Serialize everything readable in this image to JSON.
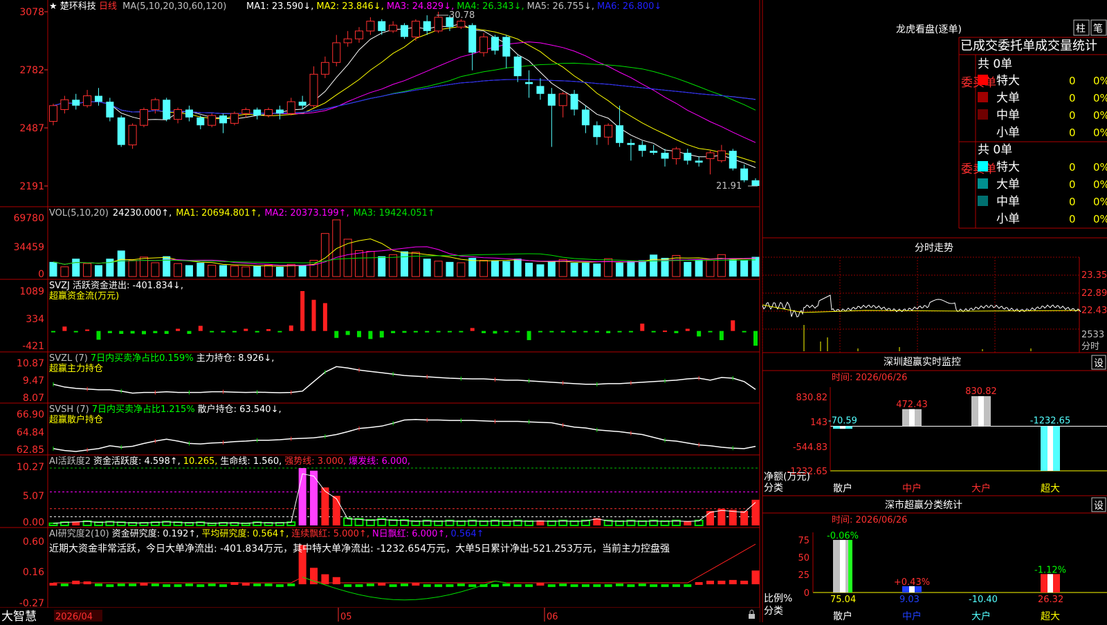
{
  "stock": {
    "star": "★",
    "name": "楚环科技",
    "period": "日线"
  },
  "main": {
    "ma_header": "MA(5,10,20,30,60,120)",
    "ma_items": [
      {
        "text": "MA1: 23.590↓,",
        "color": "#ffffff"
      },
      {
        "text": "MA2: 23.846↓,",
        "color": "#ffff00"
      },
      {
        "text": "MA3: 24.829↓,",
        "color": "#ff00ff"
      },
      {
        "text": "MA4: 26.343↓,",
        "color": "#00e000"
      },
      {
        "text": "MA5: 26.755↓,",
        "color": "#c0c0c0"
      },
      {
        "text": "MA6: 26.800↓",
        "color": "#2020ff"
      }
    ],
    "y_ticks": [
      "3078",
      "2782",
      "2487",
      "2191"
    ],
    "high_label": "30.78",
    "low_label": "21.91"
  },
  "vol": {
    "header": [
      {
        "text": "VOL(5,10,20)",
        "color": "#c0c0c0"
      },
      {
        "text": "24230.000↑,",
        "color": "#ffffff"
      },
      {
        "text": "MA1: 20694.801↑,",
        "color": "#ffff00"
      },
      {
        "text": "MA2: 20373.199↑,",
        "color": "#ff00ff"
      },
      {
        "text": "MA3: 19424.051↑",
        "color": "#00e000"
      }
    ],
    "y_ticks": [
      "69780",
      "34459",
      "0"
    ]
  },
  "svzj": {
    "header": [
      {
        "text": "SVZJ  活跃资金进出: -401.834↓,",
        "color": "#ffffff"
      }
    ],
    "sub": "超赢资金流(万元)",
    "y_ticks": [
      "1089",
      "334",
      "-421"
    ]
  },
  "svzl": {
    "header": [
      {
        "text": "SVZL (7)",
        "color": "#c0c0c0"
      },
      {
        "text": "7日内买卖净占比0.159%",
        "color": "#00ff00"
      },
      {
        "text": "主力持仓: 8.926↓,",
        "color": "#ffffff"
      }
    ],
    "sub": "超赢主力持仓",
    "y_ticks": [
      "10.87",
      "9.47",
      "8.07"
    ]
  },
  "svsh": {
    "header": [
      {
        "text": "SVSH (7)",
        "color": "#c0c0c0"
      },
      {
        "text": "7日内买卖净占比1.215%",
        "color": "#00ff00"
      },
      {
        "text": "散户持仓: 63.540↓,",
        "color": "#ffffff"
      }
    ],
    "sub": "超赢散户持仓",
    "y_ticks": [
      "66.90",
      "64.84",
      "62.85"
    ]
  },
  "ai_active": {
    "header": [
      {
        "text": "AI活跃度2",
        "color": "#c0c0c0"
      },
      {
        "text": "资金活跃度: 4.598↑,",
        "color": "#ffffff"
      },
      {
        "text": "10.265,",
        "color": "#ffff00"
      },
      {
        "text": "生命线: 1.560,",
        "color": "#ffffff"
      },
      {
        "text": "强势线: 3.000,",
        "color": "#ff3030"
      },
      {
        "text": "爆发线: 6.000,",
        "color": "#ff00ff"
      }
    ],
    "y_ticks": [
      "10.27",
      "5.07",
      "0.00"
    ]
  },
  "ai_research": {
    "header": [
      {
        "text": "AI研究度2(10)",
        "color": "#c0c0c0"
      },
      {
        "text": "资金研究度: 0.192↑,",
        "color": "#ffffff"
      },
      {
        "text": "平均研究度: 0.564↑,",
        "color": "#ffff00"
      },
      {
        "text": "连续飘红: 5.000↑,",
        "color": "#ff3030"
      },
      {
        "text": "N日飘红: 6.000↑,",
        "color": "#ff00ff"
      },
      {
        "text": "0.564↑",
        "color": "#2020ff"
      }
    ],
    "comment": "近期大资金非常活跃，今日大单净流出: -401.834万元，其中特大单净流出: -1232.654万元，大单5日累计净出-521.253万元，当前主力控盘强",
    "y_ticks": [
      "0.60",
      "0.16",
      "-0.27"
    ]
  },
  "bottom": {
    "brand": "大智慧",
    "date_start": "2026/04",
    "month1": "05",
    "month2": "06"
  },
  "dragon": {
    "title": "龙虎看盘(逐单)",
    "tab1": "柱",
    "tab2": "笔",
    "subtitle": "已成交委托单成交量统计",
    "buy_label": "委买单",
    "sell_label": "委卖单",
    "buy_total": "共 0单",
    "sell_total": "共 0单",
    "buy_rows": [
      {
        "name": "特大",
        "value": "0",
        "pct": "0%",
        "color": "#ff0000"
      },
      {
        "name": "大单",
        "value": "0",
        "pct": "0%",
        "color": "#a00000"
      },
      {
        "name": "中单",
        "value": "0",
        "pct": "0%",
        "color": "#700000"
      },
      {
        "name": "小单",
        "value": "0",
        "pct": "0%",
        "color": ""
      }
    ],
    "sell_rows": [
      {
        "name": "特大",
        "value": "0",
        "pct": "0%",
        "color": "#00ffff"
      },
      {
        "name": "大单",
        "value": "0",
        "pct": "0%",
        "color": "#009090"
      },
      {
        "name": "中单",
        "value": "0",
        "pct": "0%",
        "color": "#007070"
      },
      {
        "name": "小单",
        "value": "0",
        "pct": "0%",
        "color": ""
      }
    ]
  },
  "minute": {
    "title": "分时走势",
    "y_ticks": [
      "23.35",
      "22.89",
      "22.43"
    ],
    "vol_tick": "2533",
    "vol_unit": "分时"
  },
  "monitor": {
    "title": "深圳超赢实时监控",
    "set": "设",
    "date": "时间: 2026/06/26",
    "y_ticks": [
      "830.82",
      "143",
      "-544.83",
      "-1232.65"
    ],
    "ylabel": "净额(万元)",
    "xlabel": "分类",
    "categories": [
      "散户",
      "中户",
      "大户",
      "超大"
    ],
    "values": [
      "-70.59",
      "472.43",
      "830.82",
      "-1232.65"
    ]
  },
  "classify": {
    "title": "深市超赢分类统计",
    "set": "设",
    "date": "时间: 2026/06/26",
    "y_ticks": [
      "75",
      "50",
      "25",
      "0"
    ],
    "ylabel": "比例%",
    "xlabel": "分类",
    "categories": [
      "散户",
      "中户",
      "大户",
      "超大"
    ],
    "values": [
      "75.04",
      "9.03",
      "-10.40",
      "26.32"
    ],
    "changes": [
      "-0.06%",
      "+0.43%",
      "",
      "-1.12%"
    ]
  },
  "chart_data": [
    {
      "type": "candlestick",
      "title": "楚环科技 日线",
      "ylim": [
        21.91,
        30.78
      ],
      "y_ticks": [
        30.78,
        27.82,
        24.87,
        21.91
      ],
      "x_labels": [
        "2026/04",
        "05",
        "06"
      ],
      "candles": [
        [
          25.2,
          26.0,
          26.1,
          25.0
        ],
        [
          25.8,
          26.3,
          26.5,
          25.6
        ],
        [
          26.3,
          26.0,
          26.6,
          25.8
        ],
        [
          26.0,
          26.5,
          26.8,
          25.9
        ],
        [
          26.5,
          26.2,
          26.9,
          26.0
        ],
        [
          26.2,
          25.4,
          26.4,
          25.2
        ],
        [
          25.4,
          24.0,
          25.5,
          23.9
        ],
        [
          24.0,
          25.0,
          25.1,
          23.8
        ],
        [
          25.0,
          25.8,
          25.9,
          24.9
        ],
        [
          25.8,
          26.3,
          26.4,
          25.6
        ],
        [
          26.3,
          25.3,
          26.4,
          25.2
        ],
        [
          25.3,
          25.8,
          25.9,
          25.1
        ],
        [
          25.8,
          25.4,
          26.0,
          25.2
        ],
        [
          25.4,
          25.0,
          25.5,
          24.8
        ],
        [
          25.0,
          25.5,
          25.6,
          24.9
        ],
        [
          25.5,
          25.1,
          25.6,
          24.6
        ],
        [
          25.1,
          25.6,
          25.7,
          25.0
        ],
        [
          25.6,
          25.8,
          25.9,
          25.4
        ],
        [
          25.8,
          25.5,
          25.9,
          25.3
        ],
        [
          25.5,
          25.8,
          25.9,
          25.4
        ],
        [
          25.8,
          25.6,
          26.0,
          25.3
        ],
        [
          25.6,
          26.2,
          26.4,
          25.5
        ],
        [
          26.2,
          26.0,
          26.5,
          25.8
        ],
        [
          26.0,
          27.6,
          28.0,
          25.9
        ],
        [
          27.6,
          28.2,
          28.5,
          27.4
        ],
        [
          28.2,
          29.2,
          29.6,
          28.0
        ],
        [
          29.2,
          29.4,
          29.8,
          29.0
        ],
        [
          29.4,
          29.8,
          30.0,
          29.2
        ],
        [
          29.8,
          30.3,
          30.5,
          29.6
        ],
        [
          30.3,
          29.8,
          30.4,
          29.6
        ],
        [
          29.8,
          30.1,
          30.3,
          29.7
        ],
        [
          30.1,
          29.5,
          30.2,
          29.4
        ],
        [
          29.5,
          30.3,
          30.4,
          29.3
        ],
        [
          30.3,
          29.8,
          30.6,
          29.6
        ],
        [
          29.8,
          30.5,
          30.78,
          29.7
        ],
        [
          30.5,
          30.0,
          30.6,
          29.8
        ],
        [
          30.0,
          30.3,
          30.4,
          29.9
        ],
        [
          30.1,
          28.7,
          30.2,
          27.8
        ],
        [
          28.7,
          29.5,
          29.7,
          28.5
        ],
        [
          29.5,
          28.8,
          29.6,
          28.6
        ],
        [
          29.5,
          28.5,
          29.6,
          27.9
        ],
        [
          28.5,
          27.5,
          28.6,
          27.2
        ],
        [
          27.2,
          27.1,
          27.8,
          26.4
        ],
        [
          27.0,
          26.6,
          27.4,
          26.3
        ],
        [
          26.6,
          26.0,
          26.9,
          23.9
        ],
        [
          26.0,
          26.6,
          26.7,
          25.4
        ],
        [
          26.6,
          25.8,
          26.8,
          25.5
        ],
        [
          25.8,
          25.0,
          26.0,
          24.6
        ],
        [
          25.0,
          24.4,
          25.2,
          24.0
        ],
        [
          24.4,
          25.0,
          25.1,
          24.0
        ],
        [
          25.0,
          24.1,
          26.0,
          23.9
        ],
        [
          24.1,
          24.0,
          24.3,
          23.2
        ],
        [
          24.0,
          23.7,
          24.2,
          23.4
        ],
        [
          23.7,
          23.6,
          24.0,
          23.5
        ],
        [
          23.6,
          23.3,
          23.8,
          22.9
        ],
        [
          23.3,
          23.8,
          23.9,
          23.0
        ],
        [
          23.6,
          23.2,
          23.8,
          23.0
        ],
        [
          23.2,
          23.1,
          23.4,
          22.9
        ],
        [
          23.3,
          23.6,
          23.7,
          22.5
        ],
        [
          23.2,
          23.7,
          24.0,
          23.1
        ],
        [
          23.7,
          22.8,
          23.8,
          22.7
        ],
        [
          22.8,
          22.2,
          23.0,
          22.1
        ],
        [
          22.2,
          21.91,
          22.3,
          21.91
        ]
      ]
    },
    {
      "type": "bar",
      "title": "VOL(5,10,20)",
      "ylim": [
        0,
        69780
      ],
      "values": [
        18000,
        12000,
        22000,
        16000,
        14000,
        22000,
        32000,
        20000,
        24000,
        17000,
        25000,
        16000,
        14000,
        17000,
        14000,
        14000,
        13000,
        12000,
        13000,
        14000,
        12000,
        15000,
        14000,
        20000,
        53000,
        69780,
        46000,
        32000,
        31000,
        25000,
        27000,
        31000,
        30000,
        22000,
        19000,
        18000,
        17000,
        23000,
        20000,
        20000,
        19000,
        22000,
        17000,
        15000,
        19000,
        21000,
        17000,
        17000,
        16000,
        22000,
        17000,
        19000,
        20000,
        27000,
        23000,
        26000,
        18000,
        21000,
        20000,
        27000,
        21000,
        20000,
        24230
      ],
      "down": [
        1,
        0,
        1,
        0,
        1,
        1,
        1,
        0,
        0,
        0,
        1,
        0,
        1,
        1,
        0,
        1,
        0,
        0,
        1,
        0,
        1,
        0,
        1,
        0,
        0,
        0,
        0,
        0,
        0,
        1,
        0,
        1,
        0,
        1,
        0,
        1,
        0,
        1,
        0,
        1,
        1,
        1,
        1,
        1,
        1,
        0,
        1,
        1,
        1,
        0,
        1,
        1,
        1,
        1,
        1,
        0,
        1,
        1,
        0,
        0,
        1,
        1,
        1
      ]
    },
    {
      "type": "bar",
      "title": "SVZJ 超赢资金流(万元)",
      "ylim": [
        -421,
        1089
      ],
      "values": [
        -20,
        120,
        -30,
        40,
        -240,
        -60,
        -80,
        -70,
        -90,
        -60,
        -80,
        60,
        -80,
        140,
        -20,
        -10,
        -10,
        60,
        -40,
        50,
        -20,
        150,
        1089,
        850,
        760,
        -190,
        -110,
        -170,
        -220,
        -180,
        -60,
        -50,
        -40,
        -40,
        -20,
        -30,
        -20,
        80,
        -60,
        -70,
        -20,
        -30,
        -250,
        -20,
        -30,
        -20,
        -20,
        -20,
        -40,
        -60,
        -30,
        -20,
        200,
        -30,
        10,
        -60,
        60,
        -150,
        -20,
        -250,
        290,
        -20,
        -401.834
      ]
    },
    {
      "type": "line",
      "title": "SVZL 超赢主力持仓",
      "ylim": [
        8.07,
        10.87
      ],
      "values": [
        9.3,
        9.1,
        9.0,
        8.95,
        8.9,
        8.9,
        8.8,
        8.65,
        8.7,
        8.7,
        8.75,
        8.7,
        8.7,
        8.7,
        8.75,
        8.75,
        8.72,
        8.7,
        8.72,
        8.7,
        8.68,
        8.7,
        8.8,
        9.5,
        10.2,
        10.6,
        10.5,
        10.35,
        10.25,
        10.15,
        10.05,
        9.95,
        9.9,
        9.85,
        9.8,
        9.75,
        9.72,
        9.7,
        9.7,
        9.65,
        9.6,
        9.6,
        9.55,
        9.5,
        9.45,
        9.4,
        9.35,
        9.3,
        9.3,
        9.35,
        9.35,
        9.4,
        9.45,
        9.5,
        9.55,
        9.6,
        9.7,
        9.75,
        9.6,
        9.8,
        9.75,
        9.5,
        8.926
      ]
    },
    {
      "type": "line",
      "title": "SVSH 超赢散户持仓",
      "ylim": [
        62.85,
        66.9
      ],
      "values": [
        63.3,
        63.1,
        63.0,
        63.15,
        63.3,
        63.6,
        63.45,
        63.55,
        63.85,
        64.1,
        64.3,
        64.1,
        63.85,
        63.8,
        63.9,
        63.95,
        64.05,
        64.1,
        64.2,
        64.2,
        64.25,
        64.35,
        64.4,
        64.45,
        64.6,
        64.8,
        65.1,
        65.45,
        65.55,
        65.7,
        66.0,
        66.35,
        66.4,
        66.35,
        66.35,
        66.3,
        66.3,
        66.3,
        66.25,
        66.2,
        66.2,
        66.2,
        66.15,
        66.1,
        66.05,
        65.8,
        65.6,
        65.5,
        65.3,
        65.2,
        65.1,
        64.95,
        64.8,
        64.5,
        64.2,
        64.1,
        63.9,
        63.7,
        63.6,
        63.45,
        63.35,
        63.3,
        63.54
      ]
    },
    {
      "type": "bar",
      "title": "AI活跃度2",
      "ylim": [
        0,
        10.27
      ],
      "values": [
        0.4,
        0.6,
        0.7,
        0.8,
        0.6,
        0.7,
        0.6,
        0.5,
        0.5,
        0.6,
        0.7,
        0.6,
        0.5,
        0.6,
        0.4,
        0.5,
        0.5,
        0.4,
        0.6,
        0.5,
        0.5,
        0.6,
        10.27,
        9.8,
        6.8,
        5.3,
        1.3,
        1.2,
        1.0,
        1.2,
        1.0,
        1.0,
        0.8,
        0.9,
        0.8,
        0.9,
        0.8,
        0.9,
        0.8,
        0.9,
        0.8,
        0.9,
        0.8,
        0.9,
        0.8,
        0.9,
        0.8,
        0.9,
        1.3,
        0.9,
        0.8,
        0.9,
        0.8,
        0.9,
        0.8,
        0.9,
        0.8,
        0.9,
        2.6,
        3.0,
        2.8,
        2.6,
        4.598
      ],
      "color": [
        "g",
        "g",
        "r",
        "g",
        "g",
        "g",
        "g",
        "g",
        "g",
        "g",
        "g",
        "g",
        "g",
        "g",
        "g",
        "g",
        "g",
        "g",
        "g",
        "g",
        "g",
        "g",
        "m",
        "m",
        "r",
        "r",
        "g",
        "g",
        "g",
        "g",
        "g",
        "g",
        "g",
        "g",
        "g",
        "g",
        "g",
        "g",
        "g",
        "g",
        "g",
        "g",
        "g",
        "r",
        "g",
        "g",
        "g",
        "g",
        "r",
        "g",
        "g",
        "g",
        "g",
        "g",
        "g",
        "g",
        "r",
        "g",
        "r",
        "r",
        "r",
        "r",
        "r"
      ]
    },
    {
      "type": "bar",
      "title": "AI研究度2(10)",
      "ylim": [
        -0.27,
        0.6
      ],
      "values": [
        0.02,
        0.01,
        0.05,
        0.04,
        0.01,
        0.0,
        0.01,
        0.01,
        0.02,
        0.01,
        -0.02,
        0.0,
        0.01,
        0.0,
        0.01,
        0.0,
        0.03,
        0.02,
        0.01,
        0.01,
        0.0,
        0.01,
        0.55,
        0.23,
        0.14,
        0.1,
        -0.01,
        -0.02,
        0.01,
        0.02,
        0.0,
        0.01,
        0.02,
        0.0,
        -0.02,
        0.0,
        0.01,
        -0.01,
        0.0,
        0.0,
        0.01,
        -0.01,
        0.0,
        0.02,
        0.0,
        0.01,
        0.0,
        -0.01,
        0.0,
        0.0,
        0.01,
        0.0,
        0.01,
        0.0,
        -0.01,
        0.0,
        0.0,
        0.03,
        0.05,
        0.05,
        0.06,
        0.05,
        0.192
      ]
    },
    {
      "type": "bar",
      "title": "深圳超赢实时监控",
      "categories": [
        "散户",
        "中户",
        "大户",
        "超大"
      ],
      "values": [
        -70.59,
        472.43,
        830.82,
        -1232.65
      ],
      "ylim": [
        -1232.65,
        830.82
      ]
    },
    {
      "type": "bar",
      "title": "深市超赢分类统计",
      "categories": [
        "散户",
        "中户",
        "大户",
        "超大"
      ],
      "values": [
        75.04,
        9.03,
        -10.4,
        26.32
      ],
      "ylim": [
        0,
        75
      ]
    }
  ]
}
